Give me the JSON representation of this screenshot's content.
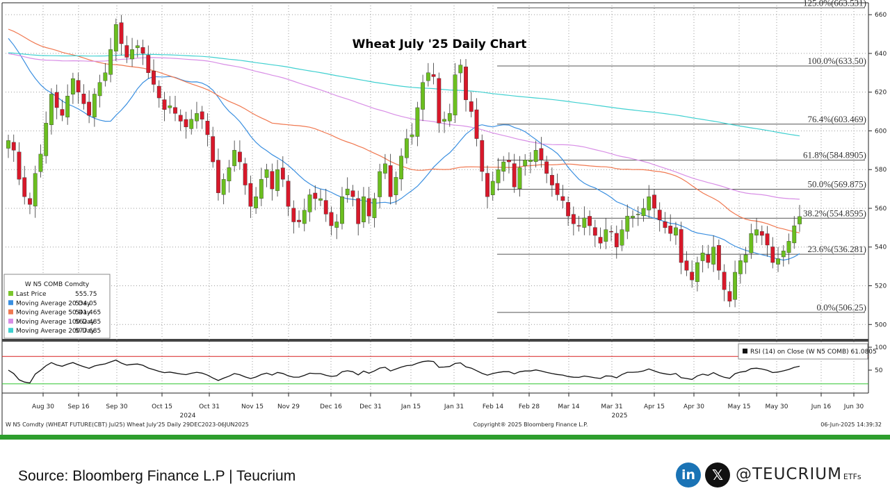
{
  "chart_data": {
    "type": "candlestick",
    "title": "Wheat July '25 Daily Chart",
    "y_range": [
      494,
      664
    ],
    "y_ticks": [
      500,
      520,
      540,
      560,
      580,
      600,
      620,
      640,
      660
    ],
    "x_tick_labels": [
      "Aug 30",
      "Sep 16",
      "Sep 30",
      "Oct 15",
      "Oct 31",
      "Nov 15",
      "Nov 29",
      "Dec 16",
      "Dec 31",
      "Jan 15",
      "Jan 31",
      "Feb 14",
      "Feb 28",
      "Mar 14",
      "Mar 31",
      "Apr 15",
      "Apr 30",
      "May 15",
      "May 30",
      "Jun 16",
      "Jun 30"
    ],
    "year_labels": [
      "2024",
      "2025"
    ],
    "close_series": [
      595,
      590,
      575,
      566,
      562,
      578,
      588,
      604,
      619,
      612,
      608,
      618,
      627,
      620,
      614,
      608,
      619,
      625,
      630,
      642,
      655,
      645,
      638,
      642,
      644,
      640,
      630,
      624,
      617,
      611,
      613,
      609,
      605,
      602,
      606,
      609,
      606,
      598,
      584,
      568,
      575,
      581,
      590,
      584,
      572,
      561,
      566,
      575,
      580,
      570,
      580,
      575,
      561,
      553,
      553,
      559,
      567,
      565,
      565,
      557,
      551,
      553,
      566,
      570,
      566,
      552,
      566,
      556,
      565,
      579,
      583,
      566,
      576,
      587,
      596,
      598,
      612,
      625,
      630,
      628,
      604,
      606,
      609,
      629,
      634,
      616,
      610,
      596,
      579,
      566,
      574,
      580,
      584,
      584,
      571,
      581,
      585,
      585,
      590,
      585,
      578,
      572,
      567,
      564,
      556,
      552,
      551,
      555,
      551,
      546,
      542,
      549,
      548,
      540,
      549,
      556,
      556,
      557,
      560,
      566,
      560,
      554,
      550,
      547,
      550,
      532,
      528,
      523,
      532,
      537,
      532,
      540,
      528,
      518,
      512,
      527,
      533,
      536,
      547,
      549,
      546,
      541,
      532,
      534,
      538,
      543,
      551,
      555.75
    ],
    "fib_levels": [
      {
        "label": "125.0%(663.531)",
        "value": 663.531
      },
      {
        "label": "100.0%(633.50)",
        "value": 633.5
      },
      {
        "label": "76.4%(603.469)",
        "value": 603.469
      },
      {
        "label": "61.8%(584.8905)",
        "value": 584.8905
      },
      {
        "label": "50.0%(569.875)",
        "value": 569.875
      },
      {
        "label": "38.2%(554.8595)",
        "value": 554.8595
      },
      {
        "label": "23.6%(536.281)",
        "value": 536.281
      },
      {
        "label": "0.0%(506.25)",
        "value": 506.25
      }
    ],
    "legend": {
      "header": "W N5 COMB Comdty",
      "entries": [
        {
          "name": "Last Price",
          "value": "555.75",
          "color": "#7bc62d"
        },
        {
          "name": "Moving Average 20 Day",
          "value": "534.05",
          "color": "#3a8fe0"
        },
        {
          "name": "Moving Average 50 Day",
          "value": "541.465",
          "color": "#f07850"
        },
        {
          "name": "Moving Average 100 Day",
          "value": "562.485",
          "color": "#d88ee6"
        },
        {
          "name": "Moving Average 200 Day",
          "value": "577.685",
          "color": "#3fd0d0"
        }
      ]
    },
    "rsi": {
      "label": "RSI (14)  on Close (W N5 COMB) 61.0805",
      "ticks": [
        50,
        100
      ],
      "upper_line": 80,
      "lower_line": 20
    },
    "colors": {
      "up": "#6bbf1f",
      "down": "#d8182a",
      "rsi_upper": "#d82020",
      "rsi_lower": "#2ec52e",
      "fib": "#555555"
    }
  },
  "footer": {
    "left_info": "W N5 Comdty (WHEAT FUTURE(CBT) Jul25) Wheat July'25  Daily 29DEC2023-06JUN2025",
    "copyright": "Copyright® 2025 Bloomberg Finance L.P.",
    "timestamp": "06-Jun-2025 14:39:32",
    "source": "Source: Bloomberg Finance L.P | Teucrium",
    "linkedin_glyph": "in",
    "x_glyph": "𝕏",
    "brand": "@TEUCRIUM",
    "brand_suffix": "ETFs"
  }
}
